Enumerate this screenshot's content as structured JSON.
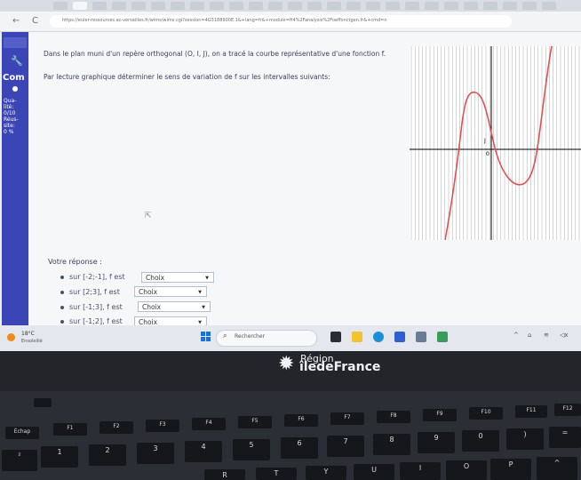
{
  "browser": {
    "url": "https://euler-ressources.ac-versailles.fr/wims/wims.cgi?session=4G3188900E.1&+lang=fr&+module=H4%2Fanalysis%2Foeffonctgen.fr&+cmd=n",
    "back_glyph": "←",
    "reload_glyph": "C"
  },
  "sidebar": {
    "label": "Com",
    "stats": "Qua-\nlité:\n0/10\nRéus-\nsite:\n0 %"
  },
  "exercise": {
    "line1": "Dans le plan muni d'un repère orthogonal (O, I, J), on a tracé la courbe représentative d'une fonction f.",
    "line2": "Par lecture graphique déterminer le sens de variation de f sur les intervalles suivants:",
    "graph_labels": {
      "j": "J",
      "o": "0"
    },
    "graph_colors": {
      "curve": "#e05252",
      "grid": "#a9a9a9",
      "axis": "#000000"
    },
    "answer_label": "Votre réponse :",
    "rows": [
      {
        "text": "sur [-2;-1], f est",
        "choice": "Choix"
      },
      {
        "text": "sur [2;3], f est",
        "choice": "Choix"
      },
      {
        "text": "sur [-1;3], f est",
        "choice": "Choix"
      },
      {
        "text": "sur [-1;2], f est",
        "choice": "Choix"
      }
    ]
  },
  "taskbar": {
    "temp": "18°C",
    "weather": "Ensoleillé",
    "search_placeholder": "Rechercher",
    "search_glyph": "⌕",
    "tray": [
      "^",
      "⌂",
      "≋",
      "◁x"
    ]
  },
  "laptop": {
    "logo_star": "✹",
    "logo_line1": "Région",
    "logo_line2": "îledeFrance",
    "keys_fn": [
      "Échap",
      "F1",
      "F2",
      "F3",
      "F4",
      "F5",
      "F6",
      "F7",
      "F8",
      "F9",
      "F10",
      "F11",
      "F12"
    ],
    "keys_num": [
      "²",
      "1",
      "2",
      "3",
      "4",
      "5",
      "6",
      "7",
      "8",
      "9",
      "0",
      ")",
      "="
    ],
    "keys_alpha": [
      "R",
      "T",
      "Y",
      "U",
      "I",
      "O",
      "P",
      "^"
    ]
  }
}
